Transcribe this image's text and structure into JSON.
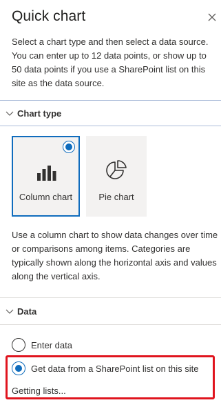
{
  "panel": {
    "title": "Quick chart",
    "intro": "Select a chart type and then select a data source. You can enter up to 12 data points, or show up to 50 data points if you use a SharePoint list on this site as the data source."
  },
  "chart_type_section": {
    "title": "Chart type",
    "options": [
      {
        "label": "Column chart",
        "selected": true,
        "icon": "column-chart-icon"
      },
      {
        "label": "Pie chart",
        "selected": false,
        "icon": "pie-chart-icon"
      }
    ],
    "description": "Use a column chart to show data changes over time or comparisons among items. Categories are typically shown along the horizontal axis and values along the vertical axis."
  },
  "data_section": {
    "title": "Data",
    "options": [
      {
        "label": "Enter data",
        "checked": false
      },
      {
        "label": "Get data from a SharePoint list on this site",
        "checked": true
      }
    ],
    "status": "Getting lists..."
  },
  "colors": {
    "accent": "#0f6cbd",
    "highlight": "#e0141e",
    "tile_background": "#f3f2f1"
  }
}
